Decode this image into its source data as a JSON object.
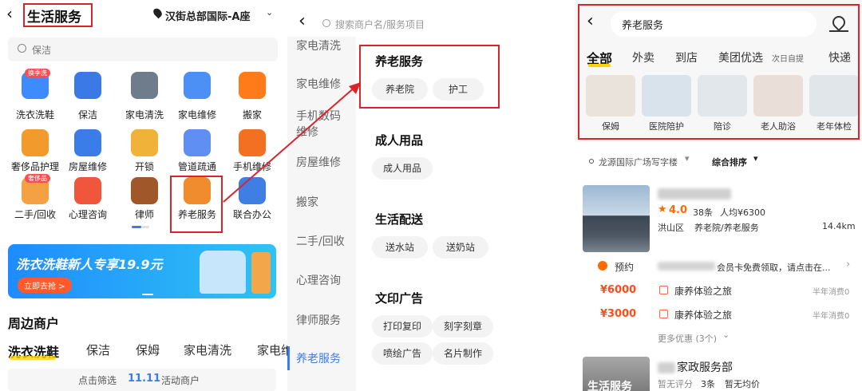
{
  "s1": {
    "title": "生活服务",
    "location": "汉街总部国际-A座",
    "search_placeholder": "保洁",
    "tiles": [
      {
        "label": "洗衣洗鞋",
        "badge": "换季洗",
        "icon": "laundry-icon",
        "color": "#3d8bff"
      },
      {
        "label": "保洁",
        "badge": "",
        "icon": "cleaning-glove-icon",
        "color": "#3b79e6"
      },
      {
        "label": "家电清洗",
        "badge": "",
        "icon": "range-hood-icon",
        "color": "#6f7c8c"
      },
      {
        "label": "家电维修",
        "badge": "",
        "icon": "washing-machine-icon",
        "color": "#4c8ff5"
      },
      {
        "label": "搬家",
        "badge": "",
        "icon": "moving-truck-icon",
        "color": "#ff7b1a"
      },
      {
        "label": "奢侈品护理",
        "badge": "",
        "icon": "luxury-bag-icon",
        "color": "#f39a2c"
      },
      {
        "label": "房屋维修",
        "badge": "",
        "icon": "repair-worker-icon",
        "color": "#3b7de8"
      },
      {
        "label": "开锁",
        "badge": "",
        "icon": "door-lock-icon",
        "color": "#f1b23a"
      },
      {
        "label": "管道疏通",
        "badge": "",
        "icon": "pipe-icon",
        "color": "#5f8ff2"
      },
      {
        "label": "手机维修",
        "badge": "",
        "icon": "phone-icon",
        "color": "#f36f22"
      },
      {
        "label": "二手/回收",
        "badge": "奢侈品",
        "icon": "recycle-box-icon",
        "color": "#f3a142"
      },
      {
        "label": "心理咨询",
        "badge": "",
        "icon": "heart-icon",
        "color": "#f0563c"
      },
      {
        "label": "律师",
        "badge": "",
        "icon": "gavel-icon",
        "color": "#a0582a"
      },
      {
        "label": "养老服务",
        "badge": "",
        "icon": "elder-care-icon",
        "color": "#f08b2e"
      },
      {
        "label": "联合办公",
        "badge": "",
        "icon": "office-icon",
        "color": "#3f7fe3"
      }
    ],
    "banner_text": "洗衣洗鞋新人专享19.9元",
    "banner_button": "立即去抢 >",
    "nearby_title": "周边商户",
    "cat_tabs": [
      "洗衣洗鞋",
      "保洁",
      "保姆",
      "家电清洗",
      "家电维"
    ],
    "filter_text": "点击筛选",
    "filter_num": "11.11",
    "filter_suffix": "活动商户"
  },
  "s2": {
    "search_placeholder": "搜索商户名/服务项目",
    "nav": [
      "家电清洗",
      "家电维修",
      "手机数码维修",
      "房屋维修",
      "搬家",
      "二手/回收",
      "心理咨询",
      "律师服务",
      "养老服务"
    ],
    "sections": [
      {
        "title": "养老服务",
        "chips": [
          "养老院",
          "护工"
        ]
      },
      {
        "title": "成人用品",
        "chips": [
          "成人用品"
        ]
      },
      {
        "title": "生活配送",
        "chips": [
          "送水站",
          "送奶站"
        ]
      },
      {
        "title": "文印广告",
        "chips": [
          "打印复印",
          "刻字刻章",
          "喷绘广告",
          "名片制作"
        ]
      }
    ]
  },
  "s3": {
    "search_text": "养老服务",
    "tabs": [
      "全部",
      "外卖",
      "到店",
      "美团优选",
      "次日自提",
      "快递"
    ],
    "subcats": [
      "保姆",
      "医院陪护",
      "陪诊",
      "老人助浴",
      "老年体检"
    ],
    "location": "龙源国际广场写字楼",
    "sort": "综合排序",
    "shop1": {
      "rating": "4.0",
      "reviews": "38条",
      "price": "人均¥6300",
      "area": "洪山区",
      "category": "养老院/养老服务",
      "distance": "14.4km",
      "reserve": "预约",
      "reserve_text": "会员卡免费领取，请点击在...",
      "deals": [
        {
          "price": "¥6000",
          "name": "康养体验之旅",
          "sales": "半年消费0"
        },
        {
          "price": "¥3000",
          "name": "康养体验之旅",
          "sales": "半年消费0"
        }
      ],
      "more": "更多优惠 (3个)"
    },
    "shop2": {
      "name_suffix": "家政服务部",
      "rating": "暂无评分",
      "reviews": "3条",
      "price": "暂无均价",
      "img_text": "生活服务"
    }
  }
}
